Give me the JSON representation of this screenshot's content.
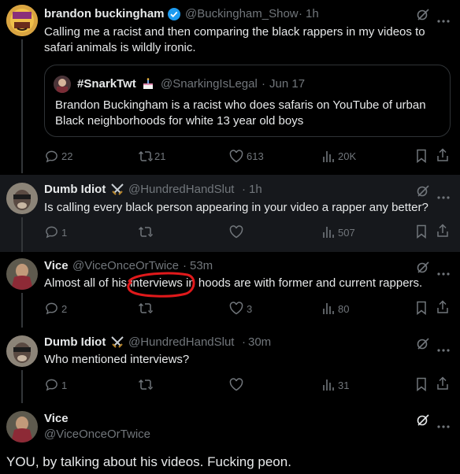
{
  "tweets": [
    {
      "display_name": "brandon buckingham",
      "handle": "@Buckingham_Show",
      "time": "1h",
      "text_lines": [
        "Calling me a racist and then comparing the black rappers in my videos to",
        "safari animals is wildly ironic."
      ],
      "quote": {
        "display_name": "#SnarkTwt",
        "handle": "@SnarkingIsLegal",
        "time": "Jun 17",
        "text_lines": [
          "Brandon Buckingham is a racist who does safaris on YouTube of urban",
          "Black neighborhoods for white 13 year old boys"
        ]
      },
      "replies": "22",
      "reposts": "21",
      "likes": "613",
      "views": "20K"
    },
    {
      "display_name": "Dumb Idiot",
      "handle": "@HundredHandSlut",
      "time": "1h",
      "text": "Is calling every black person appearing in your video a rapper any better?",
      "replies": "1",
      "reposts": "",
      "likes": "",
      "views": "507"
    },
    {
      "display_name": "Vice",
      "handle": "@ViceOnceOrTwice",
      "time": "53m",
      "text": "Almost all of his interviews in hoods are with former and current rappers.",
      "replies": "2",
      "reposts": "",
      "likes": "3",
      "views": "80"
    },
    {
      "display_name": "Dumb Idiot",
      "handle": "@HundredHandSlut",
      "time": "30m",
      "text": "Who mentioned interviews?",
      "replies": "1",
      "reposts": "",
      "likes": "",
      "views": "31"
    },
    {
      "display_name": "Vice",
      "handle": "@ViceOnceOrTwice",
      "text": "YOU, by talking about his videos. Fucking peon."
    }
  ],
  "dot": "·",
  "icons": [
    "verified-badge-icon",
    "grok-icon",
    "more-icon",
    "reply-icon",
    "repost-icon",
    "like-icon",
    "views-icon",
    "bookmark-icon",
    "share-icon",
    "swords-emoji-icon",
    "cake-emoji-icon"
  ],
  "colors": {
    "background": "#000000",
    "secondary_text": "#71767b",
    "verified": "#1d9bf0",
    "annotation": "#e0191b",
    "border": "#2f3336"
  }
}
